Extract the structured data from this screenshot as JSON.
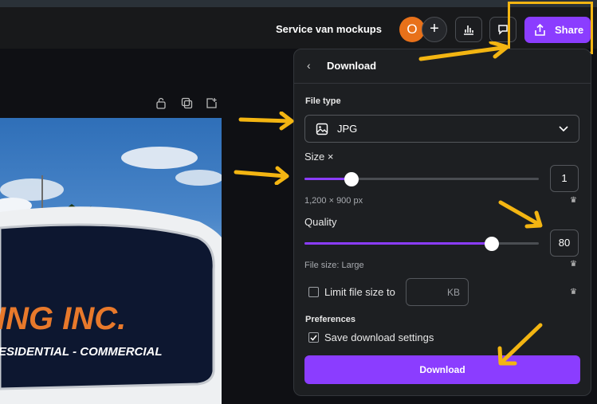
{
  "header": {
    "design_title": "Service van mockups",
    "avatar_initial": "O",
    "add_symbol": "+",
    "share_label": "Share"
  },
  "download_panel": {
    "back_symbol": "‹",
    "title": "Download",
    "file_type_label": "File type",
    "file_type_value": "JPG",
    "size_label": "Size ×",
    "size_value": "1",
    "size_slider_fraction": 0.2,
    "dimensions": "1,200 × 900 px",
    "quality_label": "Quality",
    "quality_value": "80",
    "quality_slider_fraction": 0.8,
    "file_size": "File size: Large",
    "limit_label": "Limit file size to",
    "kb_unit": "KB",
    "preferences_label": "Preferences",
    "save_settings_label": "Save download settings",
    "save_settings_checked": true,
    "download_button": "Download"
  },
  "canvas": {
    "van_text_line1": "ING INC.",
    "van_text_line2": "ESIDENTIAL - COMMERCIAL"
  },
  "colors": {
    "accent": "#8b3dff",
    "annotation": "#f3b512",
    "avatar": "#e8711a"
  }
}
